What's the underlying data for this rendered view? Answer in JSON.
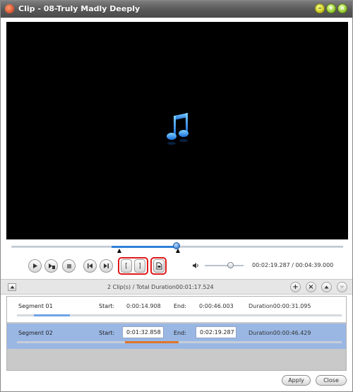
{
  "window": {
    "title": "Clip - 08-Truly Madly Deeply",
    "minimize_glyph": "–",
    "maximize_glyph": "+",
    "close_glyph": "×"
  },
  "player": {
    "time_display": "00:02:19.287 / 00:04:39.000",
    "seek_progress": 0.5,
    "volume_level": 0.6,
    "icons": [
      "play-icon",
      "play-frame-icon",
      "stop-icon",
      "previous-icon",
      "next-icon",
      "set-start-icon",
      "set-end-icon",
      "new-clip-icon",
      "volume-icon"
    ],
    "start_marker_glyph": "[",
    "end_marker_glyph": "]"
  },
  "segments_header": {
    "summary": "2 Clip(s) /  Total Duration00:01:17.524",
    "add_glyph": "+",
    "remove_glyph": "×"
  },
  "segments": [
    {
      "name": "Segment 01",
      "start_label": "Start:",
      "start": "0:00:14.908",
      "end_label": "End:",
      "end": "0:00:46.003",
      "duration": "Duration00:00:31.095",
      "selected": false
    },
    {
      "name": "Segment 02",
      "start_label": "Start:",
      "start": "0:01:32.858",
      "end_label": "End:",
      "end": "0:02:19.287",
      "duration": "Duration00:00:46.429",
      "selected": true
    }
  ],
  "buttons": {
    "apply": "Apply",
    "close": "Close"
  },
  "colors": {
    "accent": "#2f80d8",
    "selected_row": "#9ab7e4",
    "segment_fill_1": "#6fa3e4",
    "segment_fill_2": "#e0762a",
    "highlight_ring": "#e0191b"
  }
}
